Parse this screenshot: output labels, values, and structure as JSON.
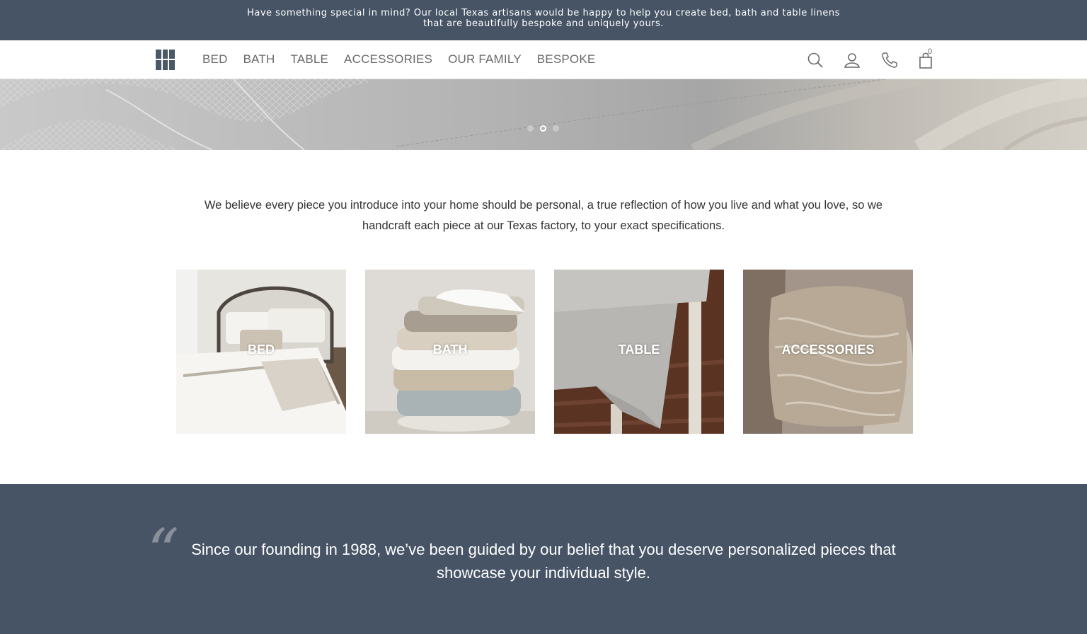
{
  "colors": {
    "brand_navy": "#465466",
    "text": "#333333",
    "nav_text": "#6a6a6a"
  },
  "announcement": {
    "line1": "Have something special in mind? Our local Texas artisans would be happy to help you create bed, bath and table linens",
    "line2": "that are beautifully bespoke and uniquely yours."
  },
  "nav": {
    "items": [
      "BED",
      "BATH",
      "TABLE",
      "ACCESSORIES",
      "OUR FAMILY",
      "BESPOKE"
    ],
    "icons": [
      "search-icon",
      "account-icon",
      "phone-icon",
      "cart-icon"
    ],
    "cart_count": "0"
  },
  "hero": {
    "slides": 3,
    "active_slide": 2
  },
  "intro": {
    "line1": "We believe every piece you introduce into your home should be personal, a true reflection of how you live and what you love, so we",
    "line2": "handcraft each piece at our Texas factory, to your exact specifications."
  },
  "categories": [
    {
      "label": "BED"
    },
    {
      "label": "BATH"
    },
    {
      "label": "TABLE"
    },
    {
      "label": "ACCESSORIES"
    }
  ],
  "quote": {
    "mark": "“",
    "line1": "Since our founding in 1988, we’ve been guided by our belief that you deserve personalized pieces that",
    "line2": "showcase your individual style."
  }
}
